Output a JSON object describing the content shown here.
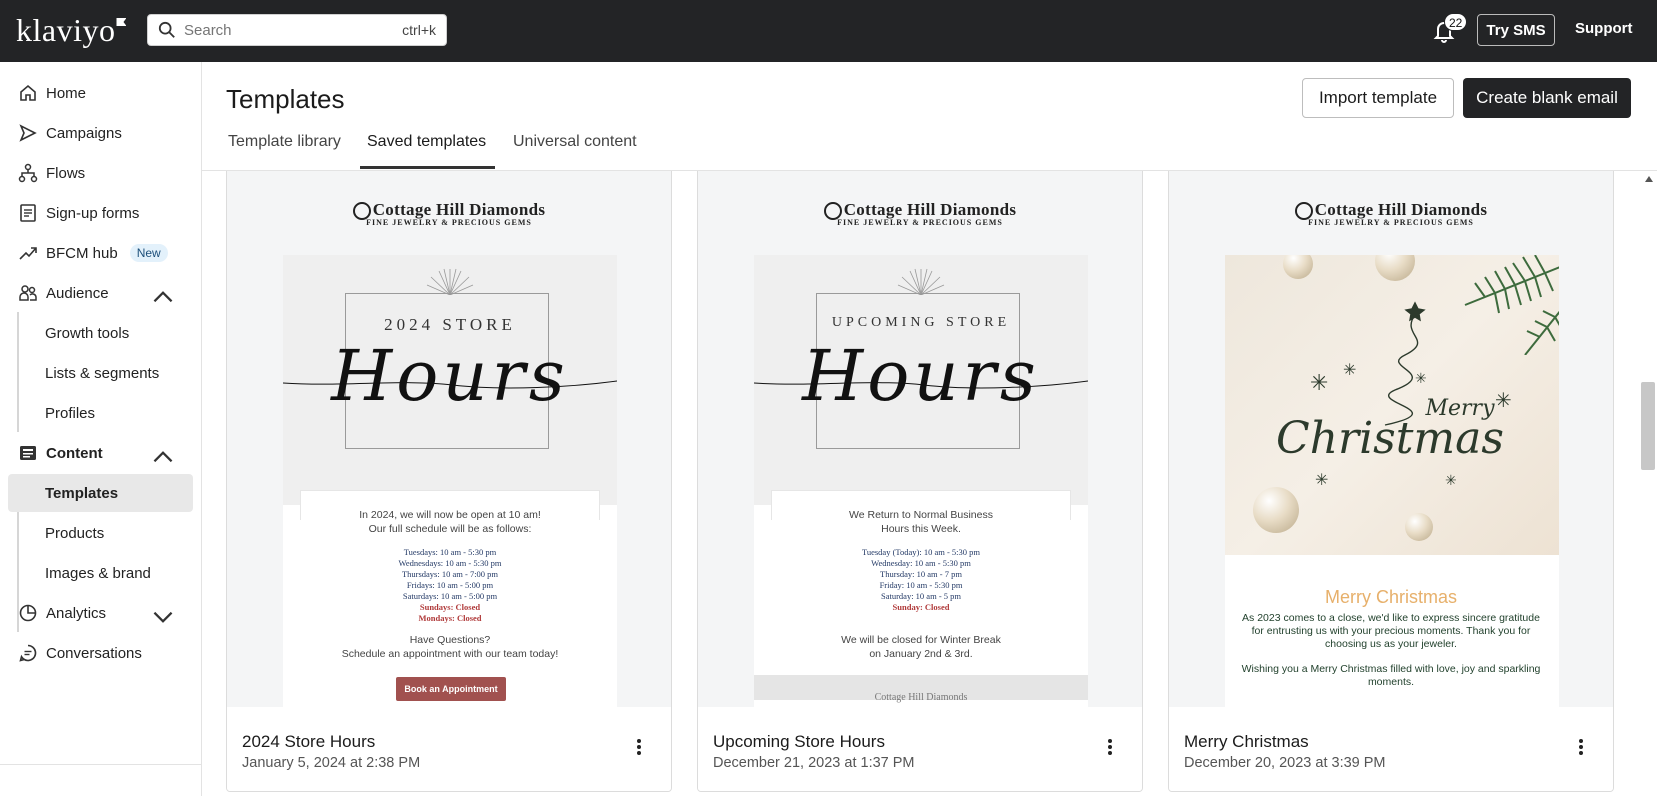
{
  "app": {
    "logo": "klaviyo"
  },
  "topbar": {
    "search_placeholder": "Search",
    "search_shortcut": "ctrl+k",
    "notification_count": "22",
    "try_sms": "Try SMS",
    "support": "Support"
  },
  "sidebar": {
    "items": [
      {
        "label": "Home",
        "icon": "home-icon"
      },
      {
        "label": "Campaigns",
        "icon": "send-icon"
      },
      {
        "label": "Flows",
        "icon": "flows-icon"
      },
      {
        "label": "Sign-up forms",
        "icon": "form-icon"
      },
      {
        "label": "BFCM hub",
        "icon": "trend-icon",
        "badge": "New"
      },
      {
        "label": "Audience",
        "icon": "people-icon",
        "expanded": true
      },
      {
        "label": "Growth tools"
      },
      {
        "label": "Lists & segments"
      },
      {
        "label": "Profiles"
      },
      {
        "label": "Content",
        "icon": "content-icon",
        "expanded": true
      },
      {
        "label": "Templates",
        "active": true
      },
      {
        "label": "Products"
      },
      {
        "label": "Images & brand"
      },
      {
        "label": "Analytics",
        "icon": "analytics-icon",
        "expanded": false
      },
      {
        "label": "Conversations",
        "icon": "chat-icon"
      }
    ]
  },
  "header": {
    "title": "Templates",
    "import_button": "Import template",
    "create_button": "Create blank email",
    "tabs": [
      {
        "label": "Template library"
      },
      {
        "label": "Saved templates",
        "active": true
      },
      {
        "label": "Universal content"
      }
    ]
  },
  "cards": [
    {
      "title": "2024 Store Hours",
      "date": "January 5, 2024 at 2:38 PM",
      "preview": {
        "brand": "Cottage Hill Diamonds",
        "brand_sub": "FINE JEWELRY & PRECIOUS GEMS",
        "kicker": "2024 STORE",
        "script": "Hours",
        "intro1": "In 2024, we will now be open at 10 am!",
        "intro2": "Our full schedule will be as follows:",
        "schedule": [
          "Tuesdays: 10 am - 5:30 pm",
          "Wednesdays: 10 am - 5:30 pm",
          "Thursdays: 10 am - 7:00 pm",
          "Fridays: 10 am - 5:00 pm",
          "Saturdays: 10 am - 5:00 pm"
        ],
        "closed": [
          "Sundays: Closed",
          "Mondays: Closed"
        ],
        "q1": "Have Questions?",
        "q2": "Schedule an appointment with our team today!",
        "cta": "Book an Appointment"
      }
    },
    {
      "title": "Upcoming Store Hours",
      "date": "December 21, 2023 at 1:37 PM",
      "preview": {
        "brand": "Cottage Hill Diamonds",
        "brand_sub": "FINE JEWELRY & PRECIOUS GEMS",
        "kicker": "UPCOMING STORE",
        "script": "Hours",
        "intro1": "We Return to Normal Business",
        "intro2": "Hours this Week.",
        "schedule": [
          "Tuesday (Today): 10 am - 5:30 pm",
          "Wednesday: 10 am - 5:30 pm",
          "Thursday: 10 am - 7 pm",
          "Friday: 10 am - 5:30 pm",
          "Saturday: 10 am - 5 pm"
        ],
        "closed": [
          "Sunday: Closed"
        ],
        "note1": "We will be closed for Winter Break",
        "note2": "on January 2nd & 3rd.",
        "footer": "Cottage Hill Diamonds"
      }
    },
    {
      "title": "Merry Christmas",
      "date": "December 20, 2023 at 3:39 PM",
      "preview": {
        "brand": "Cottage Hill Diamonds",
        "brand_sub": "FINE JEWELRY & PRECIOUS GEMS",
        "hero_merry": "Merry",
        "hero_christmas": "Christmas",
        "heading": "Merry Christmas",
        "body1": "As 2023 comes to a close, we'd like to express sincere gratitude for entrusting us with your precious moments. Thank you for choosing us as your jeweler.",
        "body2": "Wishing you a Merry Christmas filled with love, joy and sparkling moments."
      }
    }
  ],
  "colors": {
    "topbar": "#232426",
    "accent": "#a1514f",
    "gold": "#e7b06b"
  }
}
